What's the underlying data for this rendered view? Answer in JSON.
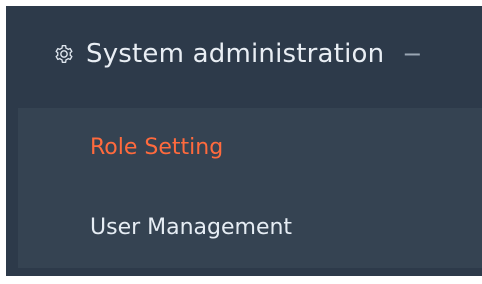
{
  "menu": {
    "group": {
      "label": "System administration",
      "icon": "gear-icon",
      "toggle": "−"
    },
    "items": [
      {
        "label": "Role Setting",
        "active": true
      },
      {
        "label": "User Management",
        "active": false
      }
    ]
  },
  "colors": {
    "sidebar_bg": "#2d3a4a",
    "submenu_bg": "#354352",
    "active_text": "#ff6a3d",
    "text": "#e6edf4"
  }
}
